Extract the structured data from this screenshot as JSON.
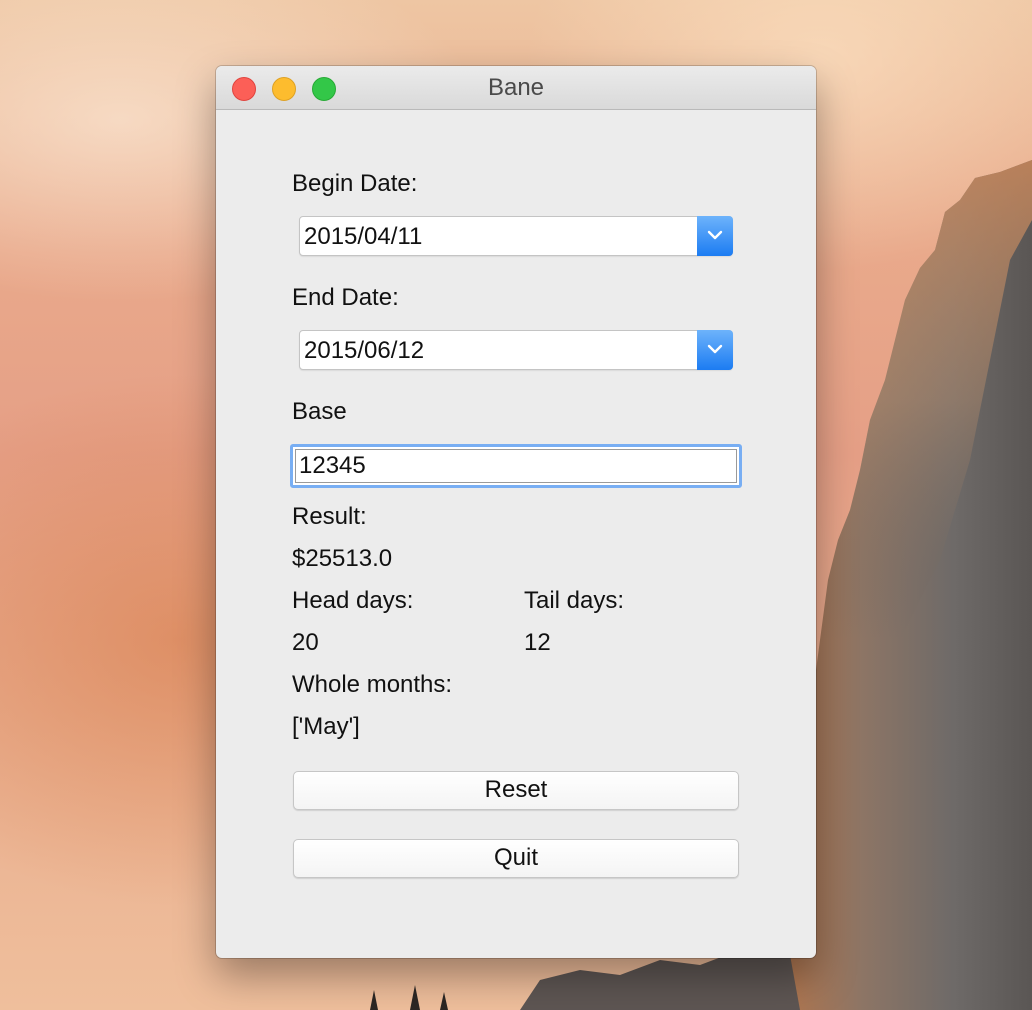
{
  "window": {
    "title": "Bane"
  },
  "form": {
    "begin_label": "Begin Date:",
    "begin_value": "2015/04/11",
    "end_label": "End Date:",
    "end_value": "2015/06/12",
    "base_label": "Base",
    "base_value": "12345",
    "result_label": "Result:",
    "result_value": "$25513.0",
    "head_label": "Head days:",
    "head_value": "20",
    "tail_label": "Tail days:",
    "tail_value": "12",
    "months_label": "Whole months:",
    "months_value": "['May']"
  },
  "buttons": {
    "reset_label": "Reset",
    "quit_label": "Quit"
  },
  "icons": {
    "dropdown": "chevron-down-icon",
    "close": "close-window-icon",
    "minimize": "minimize-window-icon",
    "maximize": "maximize-window-icon"
  },
  "colors": {
    "accent": "#1c7cf2",
    "focus_ring": "#78aef3",
    "close": "#fc5f57",
    "minimize": "#fdbc2e",
    "maximize": "#33c748"
  }
}
